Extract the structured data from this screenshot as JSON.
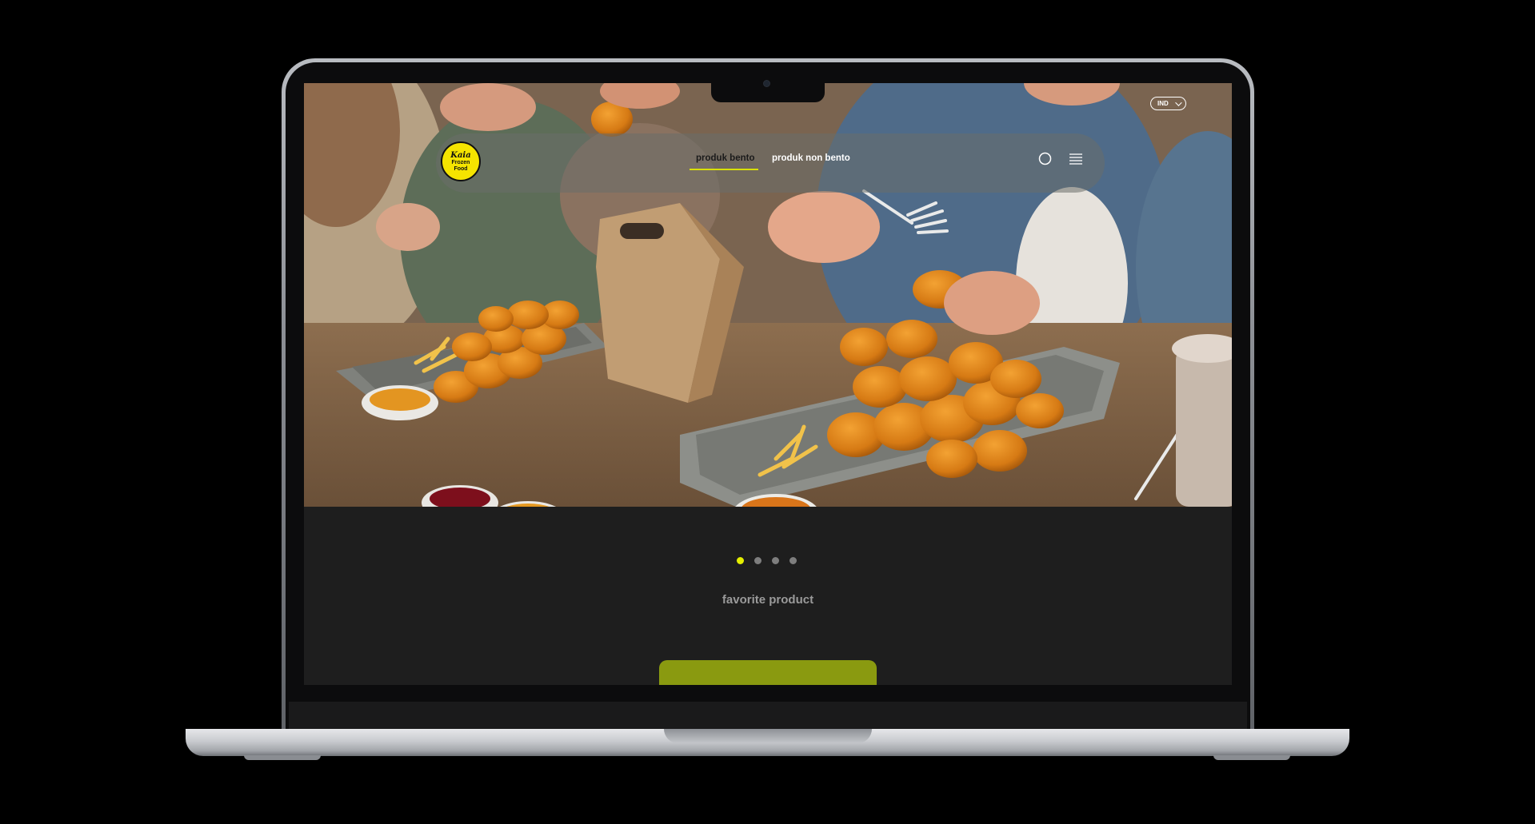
{
  "site": {
    "brand_logo": {
      "line1": "Kaia",
      "line2": "Frozen",
      "line3": "Food"
    },
    "language_selector": "IND",
    "nav": {
      "links": [
        {
          "label": "produk bento",
          "active": true
        },
        {
          "label": "produk non bento",
          "active": false
        }
      ],
      "icons": [
        "search-icon",
        "menu-icon"
      ]
    },
    "carousel": {
      "slide_count": 4,
      "active_index": 0
    },
    "section_title": "favorite product",
    "colors": {
      "accent_yellow": "#e4ee00",
      "cta_green": "#8a9a10",
      "page_background": "#1e1e1e",
      "logo_yellow": "#f5e400"
    }
  }
}
